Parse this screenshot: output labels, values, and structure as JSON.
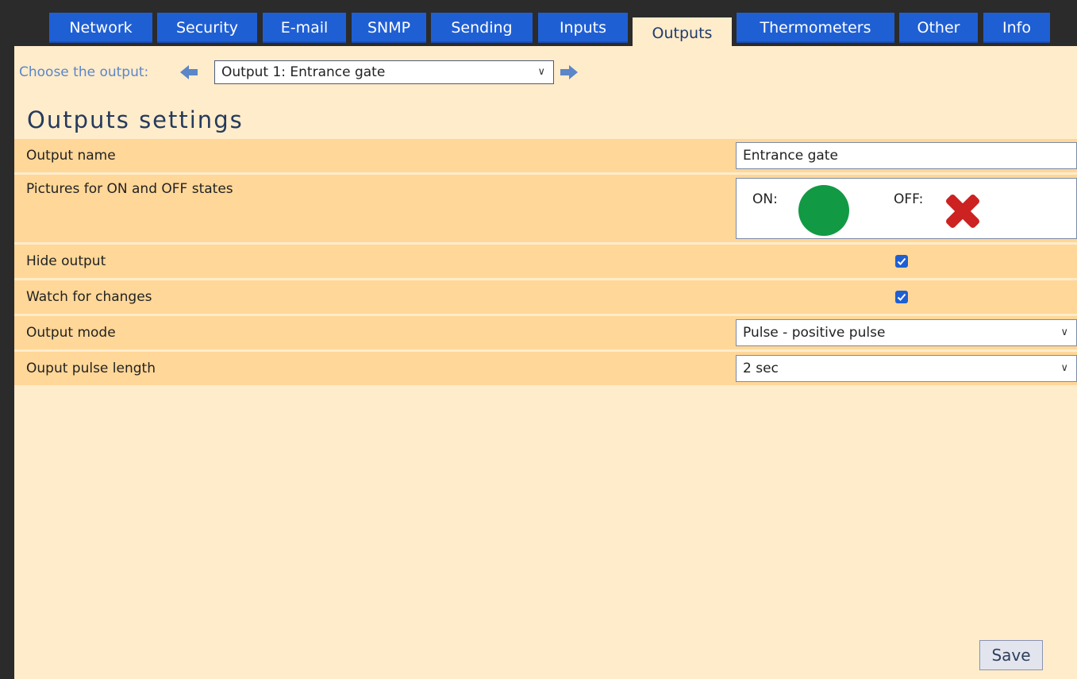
{
  "tabs": [
    {
      "label": "Network"
    },
    {
      "label": "Security"
    },
    {
      "label": "E-mail"
    },
    {
      "label": "SNMP"
    },
    {
      "label": "Sending"
    },
    {
      "label": "Inputs"
    },
    {
      "label": "Outputs",
      "active": true
    },
    {
      "label": "Thermometers"
    },
    {
      "label": "Other"
    },
    {
      "label": "Info"
    }
  ],
  "chooser": {
    "label": "Choose the output:",
    "selected": "Output 1: Entrance gate"
  },
  "title": "Outputs settings",
  "rows": {
    "output_name": {
      "label": "Output name",
      "value": "Entrance gate"
    },
    "pictures": {
      "label": "Pictures for ON and OFF states",
      "on_label": "ON:",
      "off_label": "OFF:"
    },
    "hide_output": {
      "label": "Hide output",
      "checked": true
    },
    "watch_changes": {
      "label": "Watch for changes",
      "checked": true
    },
    "output_mode": {
      "label": "Output mode",
      "value": "Pulse - positive pulse"
    },
    "pulse_length": {
      "label": "Ouput pulse length",
      "value": "2 sec"
    }
  },
  "save_label": "Save",
  "colors": {
    "tab_blue": "#1f5fd4",
    "background": "#ffeccb",
    "row_highlight": "#ffd798",
    "on_green": "#129944",
    "off_red": "#cc2222"
  }
}
